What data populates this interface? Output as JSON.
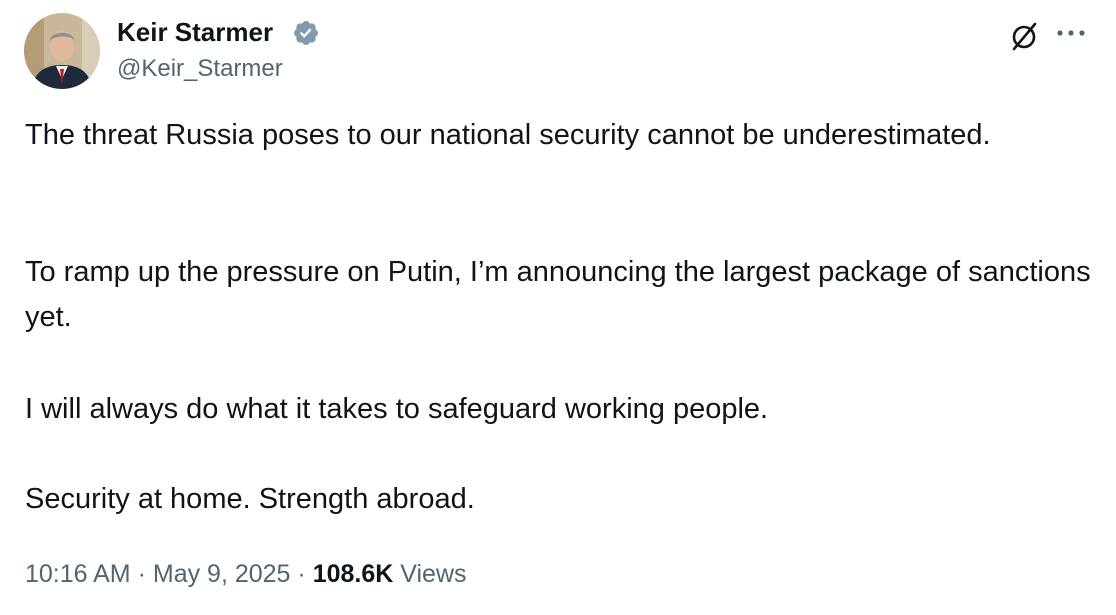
{
  "author": {
    "display_name": "Keir Starmer",
    "handle": "@Keir_Starmer",
    "verified": true,
    "verified_color": "#829aab"
  },
  "icons": {
    "grok": "grok-icon",
    "more": "more-icon",
    "verified": "verified-badge-icon"
  },
  "tweet": {
    "paragraphs": [
      "The threat Russia poses to our national security cannot be underestimated.",
      "To ramp up the pressure on Putin, I’m announcing the largest package of sanctions yet.",
      "I will always do what it takes to safeguard working people.",
      "Security at home. Strength abroad."
    ]
  },
  "meta": {
    "time": "10:16 AM",
    "separator": "·",
    "date": "May 9, 2025",
    "views_count": "108.6K",
    "views_label": "Views"
  },
  "colors": {
    "text": "#0f1419",
    "secondary": "#536471"
  }
}
